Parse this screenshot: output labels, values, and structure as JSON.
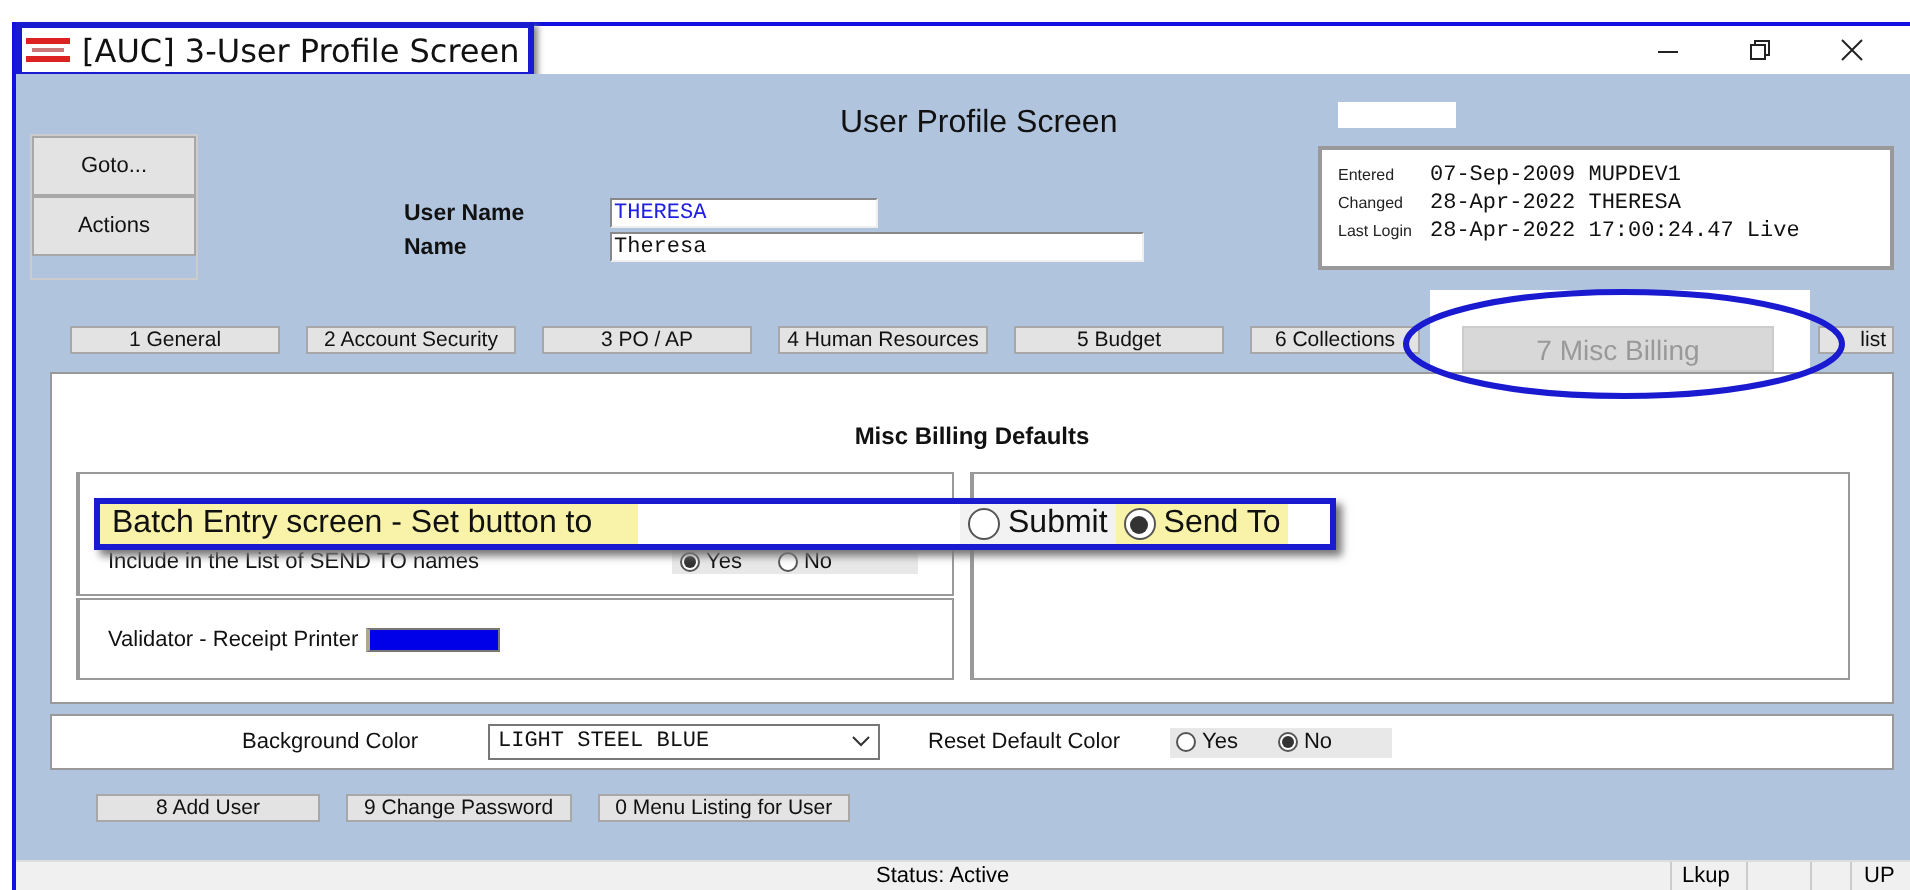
{
  "window": {
    "title": "[AUC] 3-User Profile Screen"
  },
  "side_buttons": [
    "Goto...",
    "Actions"
  ],
  "screen_title": "User Profile Screen",
  "user_fields": [
    {
      "label": "User Name",
      "value": "THERESA",
      "kind": "code"
    },
    {
      "label": "Name",
      "value": "Theresa",
      "kind": "text"
    }
  ],
  "audit": [
    {
      "label": "Entered",
      "value": "07-Sep-2009 MUPDEV1"
    },
    {
      "label": "Changed",
      "value": "28-Apr-2022 THERESA"
    },
    {
      "label": "Last Login",
      "value": "28-Apr-2022 17:00:24.47 Live"
    }
  ],
  "tabs": [
    {
      "label": "1 General",
      "selected": false
    },
    {
      "label": "2 Account Security",
      "selected": false
    },
    {
      "label": "3 PO / AP",
      "selected": false
    },
    {
      "label": "4 Human Resources",
      "selected": false
    },
    {
      "label": "5 Budget",
      "selected": false
    },
    {
      "label": "6 Collections",
      "selected": false
    },
    {
      "label": "7 Misc Billing",
      "selected": true
    },
    {
      "label": "list",
      "selected": false
    }
  ],
  "section_title": "Misc Billing Defaults",
  "settings": [
    {
      "label": "Include in the List of SEND TO names",
      "options": [
        {
          "label": "Yes",
          "selected": true
        },
        {
          "label": "No",
          "selected": false
        }
      ]
    }
  ],
  "validator": {
    "label": "Validator - Receipt Printer"
  },
  "callout": {
    "text": "Batch Entry screen - Set button to",
    "options": [
      {
        "label": "Submit",
        "selected": false
      },
      {
        "label": "Send To",
        "selected": true
      }
    ]
  },
  "background_color": {
    "label": "Background Color",
    "value": "LIGHT STEEL BLUE"
  },
  "reset_default_color": {
    "label": "Reset Default Color",
    "options": [
      {
        "label": "Yes",
        "selected": false
      },
      {
        "label": "No",
        "selected": true
      }
    ]
  },
  "bottom_buttons": [
    "8 Add User",
    "9 Change Password",
    "0 Menu Listing for User"
  ],
  "status_bar": {
    "status": "Status: Active",
    "lookup": "Lkup",
    "mode": "UP"
  }
}
